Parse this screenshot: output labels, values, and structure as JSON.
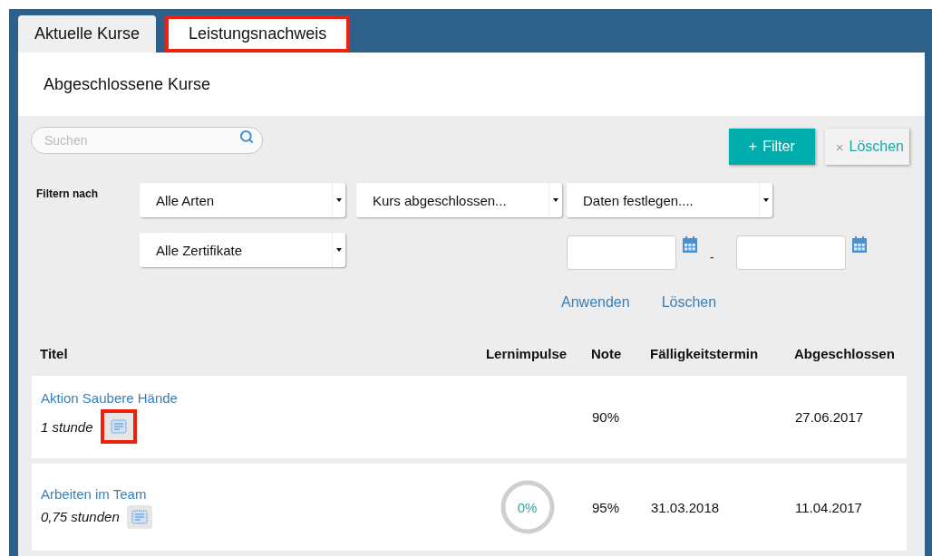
{
  "tabs": [
    {
      "label": "Aktuelle Kurse",
      "selected": false,
      "highlighted": false
    },
    {
      "label": "Leistungsnachweis",
      "selected": true,
      "highlighted": true
    }
  ],
  "section_title": "Abgeschlossene Kurse",
  "search": {
    "placeholder": "Suchen"
  },
  "buttons": [
    {
      "kind": "primary",
      "icon": "+",
      "label": "Filter"
    },
    {
      "kind": "secondary",
      "icon": "×",
      "label": "Löschen"
    }
  ],
  "filter": {
    "label": "Filtern nach",
    "dropdowns": [
      {
        "value": "Alle Arten"
      },
      {
        "value": "Kurs abgeschlossen..."
      },
      {
        "value": "Daten festlegen...."
      },
      {
        "value": "Alle Zertifikate"
      }
    ],
    "date_separator": "-",
    "actions": [
      "Anwenden",
      "Löschen"
    ]
  },
  "table": {
    "columns": [
      "Titel",
      "Lernimpulse",
      "Note",
      "Fälligkeitstermin",
      "Abgeschlossen"
    ],
    "rows": [
      {
        "title": "Aktion Saubere Hände",
        "duration": "1 stunde",
        "certificate_highlighted": true,
        "note": "90%",
        "completed": "27.06.2017"
      },
      {
        "title": "Arbeiten im Team",
        "duration": "0,75 stunden",
        "certificate_highlighted": false,
        "lernimpulse": {
          "reading": "0%"
        },
        "note": "95%",
        "due": "31.03.2018",
        "completed": "11.04.2017"
      }
    ]
  }
}
